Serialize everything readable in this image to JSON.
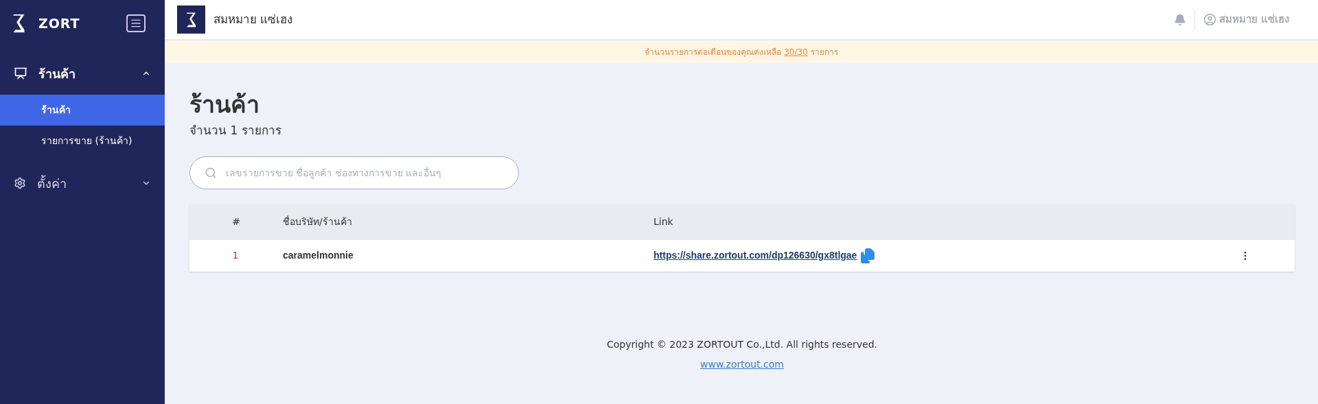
{
  "sidebar": {
    "brand": "ZORT",
    "groups": [
      {
        "label": "ร้านค้า",
        "expanded": true,
        "children": [
          {
            "label": "ร้านค้า",
            "selected": true
          },
          {
            "label": "รายการขาย (ร้านค้า)",
            "selected": false
          }
        ]
      },
      {
        "label": "ตั้งค่า",
        "expanded": false
      }
    ]
  },
  "header": {
    "shop_name": "สมหมาย แซ่เฮง",
    "user_name": "สมหมาย แซ่เฮง"
  },
  "banner": {
    "text_before": "จำนวนรายการต่อเดือนของคุณคงเหลือ",
    "quota": "30/30",
    "text_after": "รายการ"
  },
  "page": {
    "title": "ร้านค้า",
    "count": "จำนวน 1 รายการ"
  },
  "search": {
    "placeholder": "เลขรายการขาย ชื่อลูกค้า ช่องทางการขาย และอื่นๆ"
  },
  "table": {
    "columns": [
      "#",
      "ชื่อบริษัท/ร้านค้า",
      "Link"
    ],
    "rows": [
      {
        "index": "1",
        "name": "caramelmonnie",
        "link": "https://share.zortout.com/dp126630/gx8tlgae"
      }
    ]
  },
  "footer": {
    "copyright": "Copyright © 2023 ZORTOUT Co.,Ltd. All rights reserved.",
    "link": "www.zortout.com"
  }
}
